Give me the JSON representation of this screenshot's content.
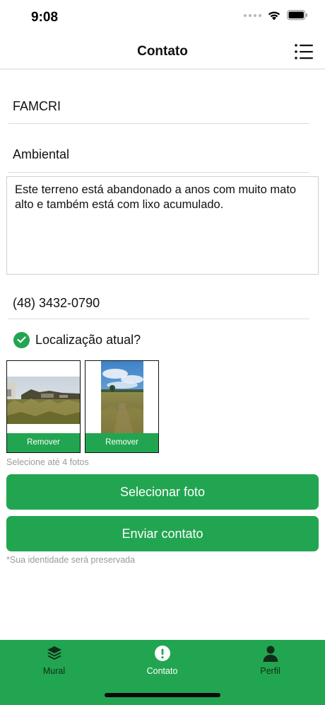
{
  "status_bar": {
    "time": "9:08"
  },
  "nav": {
    "title": "Contato"
  },
  "form": {
    "organization": "FAMCRI",
    "category": "Ambiental",
    "description": "Este terreno está abandonado a anos com muito mato alto e também está com lixo acumulado.",
    "phone": "(48) 3432-0790",
    "use_current_location": {
      "label": "Localização atual?",
      "checked": true
    }
  },
  "photos": {
    "items": [
      {
        "remove_label": "Remover"
      },
      {
        "remove_label": "Remover"
      }
    ],
    "hint": "Selecione até 4 fotos"
  },
  "actions": {
    "select_photo": "Selecionar foto",
    "send_contact": "Enviar contato",
    "privacy_note": "*Sua identidade será preservada"
  },
  "tab_bar": {
    "active": "Contato",
    "tabs": [
      {
        "label": "Mural",
        "icon": "layers-icon"
      },
      {
        "label": "Contato",
        "icon": "alert-circle-icon"
      },
      {
        "label": "Perfil",
        "icon": "person-icon"
      }
    ]
  },
  "colors": {
    "accent": "#22a550",
    "tab_inactive_text": "#0f2d18",
    "hint_text": "#9a9a9a"
  }
}
